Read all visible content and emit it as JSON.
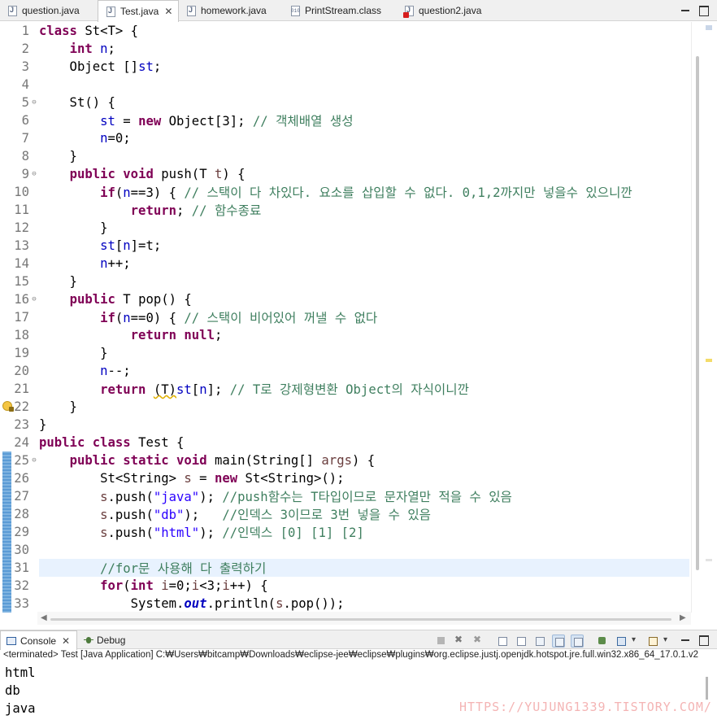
{
  "editor_tabs": [
    {
      "label": "question.java",
      "icon": "java-file-icon",
      "active": false
    },
    {
      "label": "Test.java",
      "icon": "java-file-icon",
      "active": true,
      "close": "✕"
    },
    {
      "label": "homework.java",
      "icon": "java-file-icon",
      "active": false
    },
    {
      "label": "PrintStream.class",
      "icon": "class-file-icon",
      "active": false
    },
    {
      "label": "question2.java",
      "icon": "java-error-file-icon",
      "active": false
    }
  ],
  "window_controls": {
    "minimize": "minimize-icon",
    "maximize": "maximize-icon"
  },
  "code_lines": [
    "class St<T> {",
    "    int n;",
    "    Object []st;",
    "",
    "    St() {",
    "        st = new Object[3]; // 객체배열 생성",
    "        n=0;",
    "    }",
    "    public void push(T t) {",
    "        if(n==3) { // 스택이 다 차있다. 요소를 삽입할 수 없다. 0,1,2까지만 넣을수 있으니깐",
    "            return; // 함수종료",
    "        }",
    "        st[n]=t;",
    "        n++;",
    "    }",
    "    public T pop() {",
    "        if(n==0) { // 스택이 비어있어 꺼낼 수 없다",
    "            return null;",
    "        }",
    "        n--;",
    "        return (T)st[n]; // T로 강제형변환 Object의 자식이니깐",
    "    }",
    "}",
    "public class Test {",
    "    public static void main(String[] args) {",
    "        St<String> s = new St<String>();",
    "        s.push(\"java\"); //push함수는 T타입이므로 문자열만 적을 수 있음",
    "        s.push(\"db\");   //인덱스 3이므로 3번 넣을 수 있음",
    "        s.push(\"html\"); //인덱스 [0] [1] [2]",
    "",
    "        //for문 사용해 다 출력하기",
    "        for(int i=0;i<3;i++) {",
    "            System.out.println(s.pop());"
  ],
  "line_numbers": [
    "1",
    "2",
    "3",
    "4",
    "5",
    "6",
    "7",
    "8",
    "9",
    "10",
    "11",
    "12",
    "13",
    "14",
    "15",
    "16",
    "17",
    "18",
    "19",
    "20",
    "21",
    "22",
    "23",
    "24",
    "25",
    "26",
    "27",
    "28",
    "29",
    "30",
    "31",
    "32",
    "33"
  ],
  "fold_markers": {
    "5": "⊖",
    "9": "⊖",
    "16": "⊖",
    "25": "⊖"
  },
  "console": {
    "tabs": [
      {
        "label": "Console",
        "icon": "console-icon",
        "active": true,
        "close": "✕"
      },
      {
        "label": "Debug",
        "icon": "debug-icon",
        "active": false
      }
    ],
    "status": "<terminated> Test [Java Application] C:₩Users₩bitcamp₩Downloads₩eclipse-jee₩eclipse₩plugins₩org.eclipse.justj.openjdk.hotspot.jre.full.win32.x86_64_17.0.1.v2",
    "output": [
      "html",
      "db",
      "java"
    ]
  },
  "watermark": "HTTPS://YUJUNG1339.TISTORY.COM/",
  "colors": {
    "keyword": "#7f0055",
    "field": "#0000c0",
    "comment": "#3f7f5f",
    "string": "#2a00ff",
    "current_line": "#e8f2fe"
  }
}
